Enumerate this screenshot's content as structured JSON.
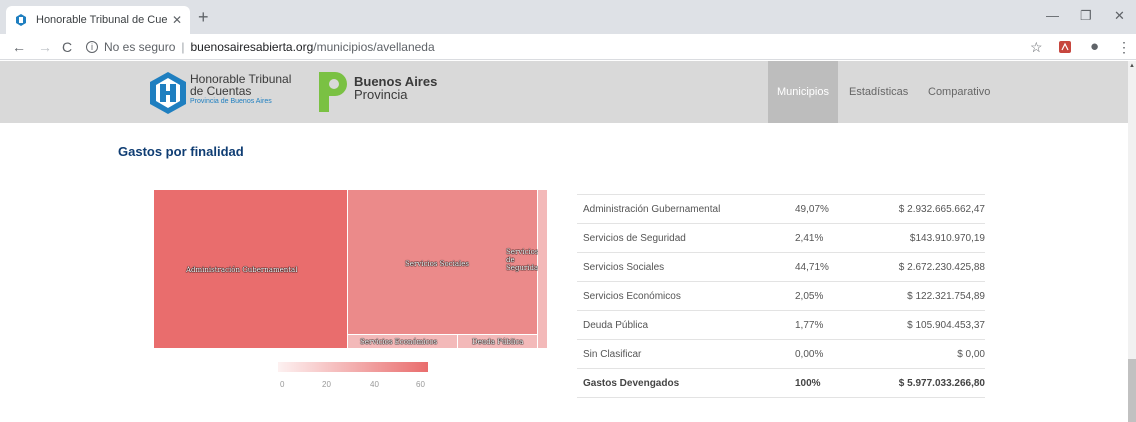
{
  "browser": {
    "tab_title": "Honorable Tribunal de Cuentas d",
    "tab_close": "✕",
    "new_tab": "+",
    "minimize": "—",
    "maximize": "❐",
    "close": "✕",
    "back": "←",
    "forward": "→",
    "reload": "C",
    "security_label": "No es seguro",
    "url_host": "buenosairesabierta.org",
    "url_path": "/municipios/avellaneda",
    "star": "☆",
    "profile": "●",
    "more": "⋮"
  },
  "header": {
    "logo1_line1": "Honorable Tribunal",
    "logo1_line2": "de Cuentas",
    "logo1_line3": "Provincia de Buenos Aires",
    "logo2_line1": "Buenos Aires",
    "logo2_line2": "Provincia",
    "nav": [
      {
        "label": "Municipios"
      },
      {
        "label": "Estadísticas"
      },
      {
        "label": "Comparativo"
      }
    ]
  },
  "section_title": "Gastos por finalidad",
  "treemap": {
    "cells": [
      {
        "label": "Administración Gubernamental",
        "value": 49.07
      },
      {
        "label": "Servicios Sociales",
        "value": 44.71
      },
      {
        "label": "Servicios de Seguridad",
        "label_lines": [
          "Servicios",
          "de",
          "Seguridad"
        ],
        "value": 2.41
      },
      {
        "label": "Servicios Económicos",
        "value": 2.05
      },
      {
        "label": "Deuda Pública",
        "value": 1.77
      }
    ],
    "colors": {
      "high": "#e96d6d",
      "mid": "#eb8a8a",
      "low": "#f3b9b9"
    },
    "legend_ticks": [
      "0",
      "20",
      "40",
      "60"
    ]
  },
  "table": {
    "rows": [
      {
        "name": "Administración Gubernamental",
        "pct": "49,07%",
        "amount": "$ 2.932.665.662,47"
      },
      {
        "name": "Servicios de Seguridad",
        "pct": "2,41%",
        "amount": "$143.910.970,19"
      },
      {
        "name": "Servicios Sociales",
        "pct": "44,71%",
        "amount": "$ 2.672.230.425,88"
      },
      {
        "name": "Servicios Económicos",
        "pct": "2,05%",
        "amount": "$ 122.321.754,89"
      },
      {
        "name": "Deuda Pública",
        "pct": "1,77%",
        "amount": "$ 105.904.453,37"
      },
      {
        "name": "Sin Clasificar",
        "pct": "0,00%",
        "amount": "$ 0,00"
      },
      {
        "name": "Gastos Devengados",
        "pct": "100%",
        "amount": "$ 5.977.033.266,80"
      }
    ]
  }
}
